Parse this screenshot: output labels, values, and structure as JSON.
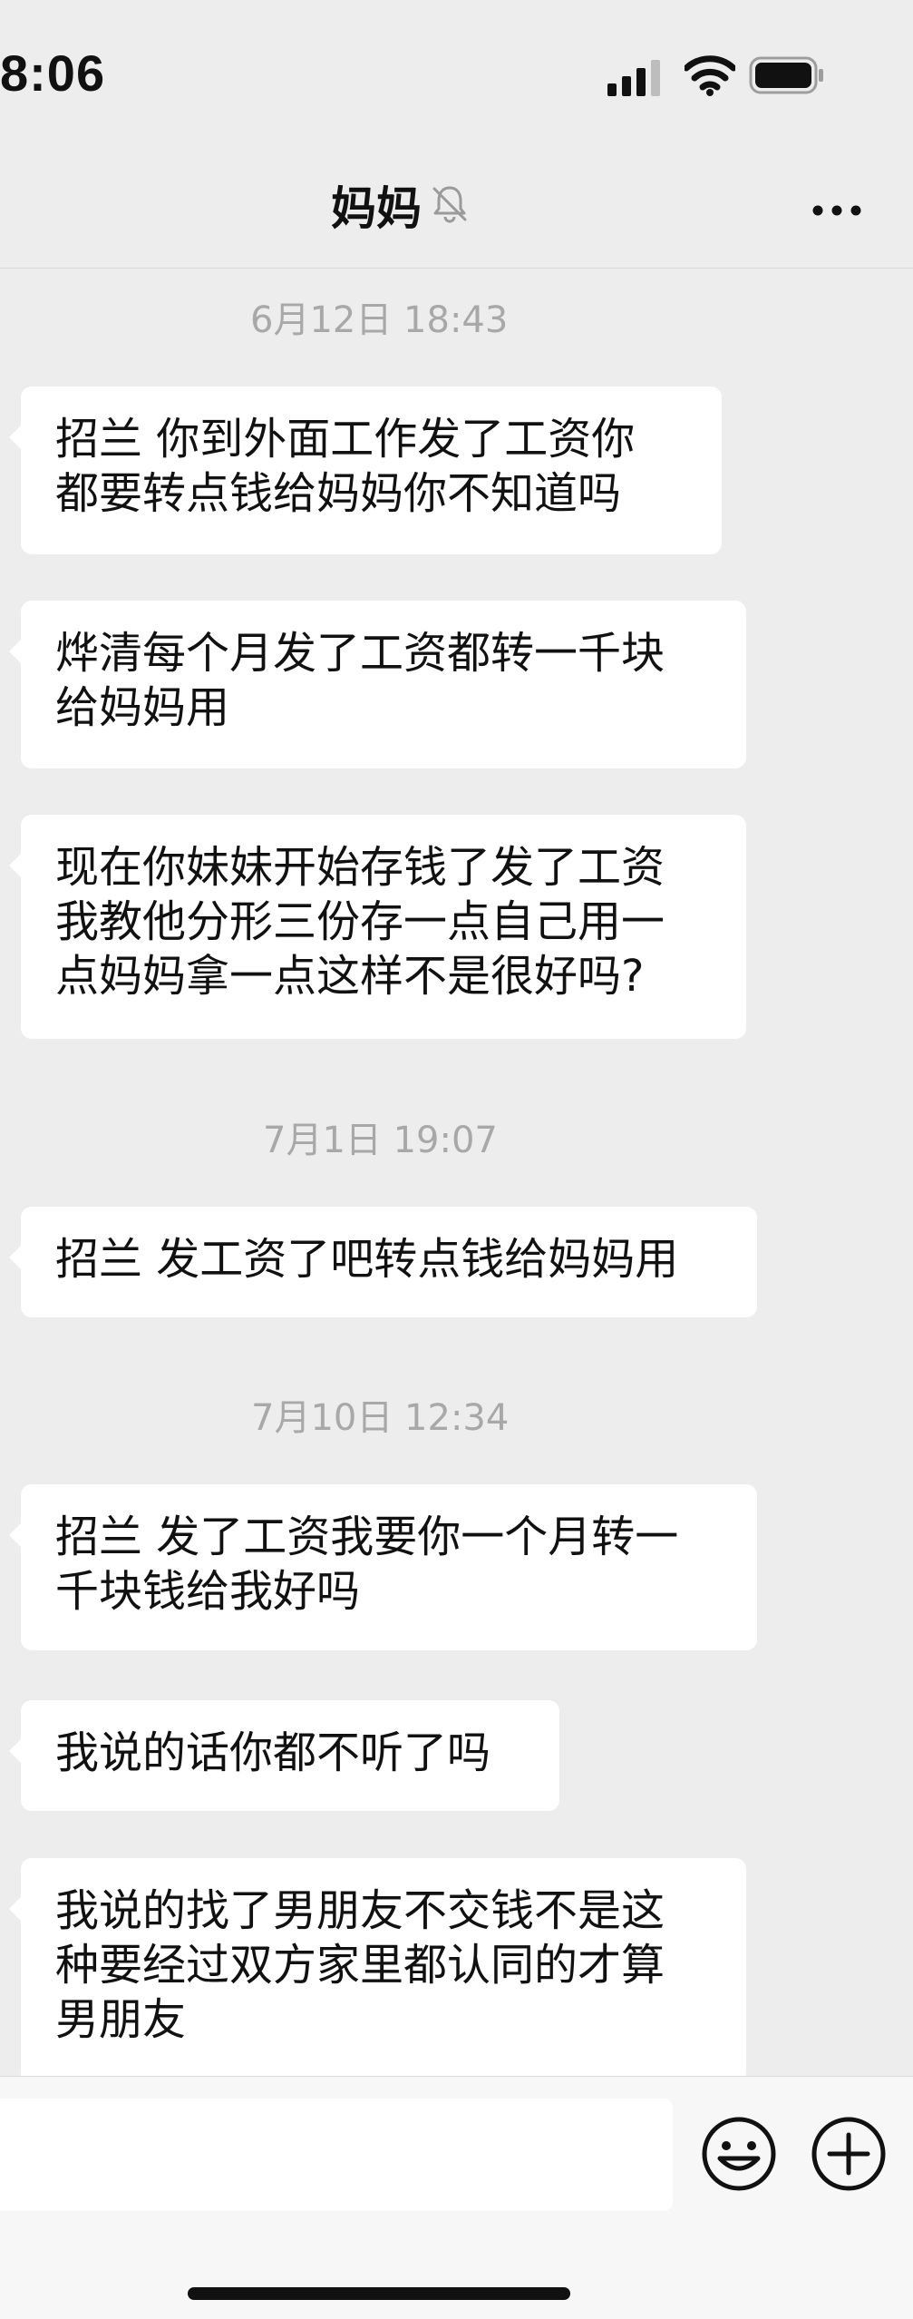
{
  "status_bar": {
    "time": "8:06",
    "icons": [
      "signal-icon",
      "wifi-icon",
      "battery-icon"
    ]
  },
  "header": {
    "title": "妈妈",
    "icons": [
      "mute-bell-icon",
      "more-icon"
    ]
  },
  "chat": {
    "timestamps": [
      "6月12日 18:43",
      "7月1日 19:07",
      "7月10日 12:34"
    ],
    "messages": [
      {
        "lines": [
          "招兰  你到外面工作发了工资你",
          "都要转点钱给妈妈你不知道吗"
        ]
      },
      {
        "lines": [
          "烨清每个月发了工资都转一千块",
          "给妈妈用"
        ]
      },
      {
        "lines": [
          "现在你妹妹开始存钱了发了工资",
          "我教他分形三份存一点自己用一",
          "点妈妈拿一点这样不是很好吗?"
        ]
      },
      {
        "lines": [
          "招兰 发工资了吧转点钱给妈妈用"
        ]
      },
      {
        "lines": [
          "招兰 发了工资我要你一个月转一",
          "千块钱给我好吗"
        ]
      },
      {
        "lines": [
          "我说的话你都不听了吗"
        ]
      },
      {
        "lines": [
          "我说的找了男朋友不交钱不是这",
          "种要经过双方家里都认同的才算",
          "男朋友"
        ]
      }
    ]
  },
  "input_bar": {
    "placeholder": "",
    "icons": [
      "emoji-icon",
      "plus-icon"
    ]
  },
  "colors": {
    "background": "#ededed",
    "bubble": "#ffffff",
    "timestamp": "#a8a8a8",
    "text": "#111111"
  }
}
